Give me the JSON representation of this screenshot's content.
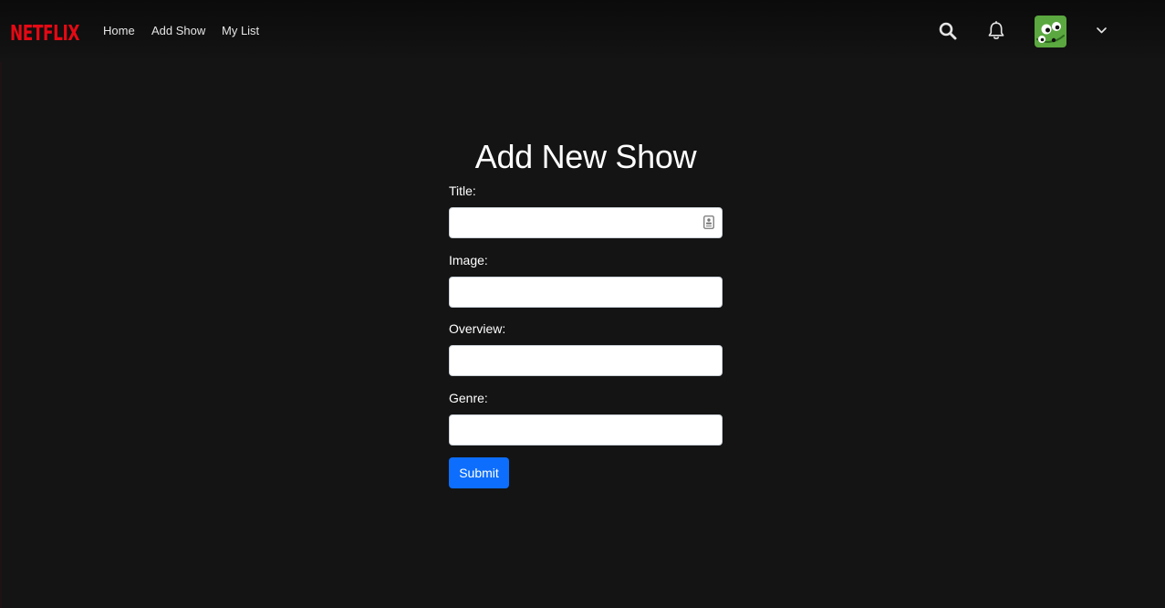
{
  "navbar": {
    "logo_text": "NETFLIX",
    "links": [
      {
        "label": "Home"
      },
      {
        "label": "Add Show"
      },
      {
        "label": "My List"
      }
    ],
    "icons": [
      "search-icon",
      "bell-icon",
      "avatar",
      "chevron-down-icon"
    ]
  },
  "form": {
    "title": "Add New Show",
    "fields": [
      {
        "label": "Title:",
        "value": "",
        "placeholder": ""
      },
      {
        "label": "Image:",
        "value": "",
        "placeholder": ""
      },
      {
        "label": "Overview:",
        "value": "",
        "placeholder": ""
      },
      {
        "label": "Genre:",
        "value": "",
        "placeholder": ""
      }
    ],
    "submit_label": "Submit"
  },
  "colors": {
    "background": "#141414",
    "brand_red": "#e50914",
    "primary_button": "#0d6efd",
    "avatar_green": "#5aa83f"
  }
}
